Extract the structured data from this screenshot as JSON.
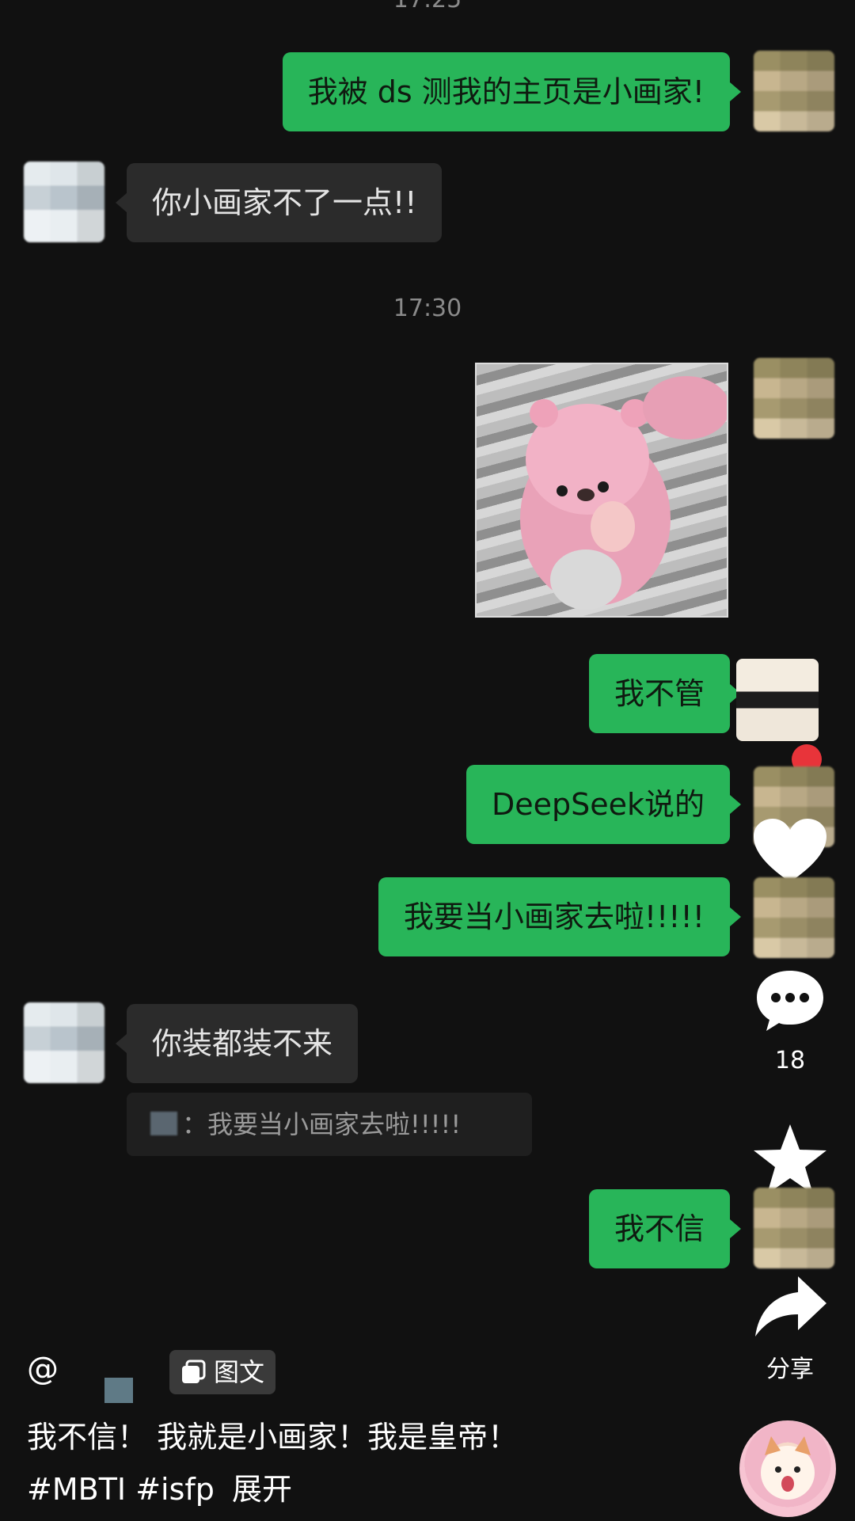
{
  "timestamps": {
    "top": "17:25",
    "middle": "17:30"
  },
  "messages": [
    {
      "side": "me",
      "text": "我被 ds 测我的主页是小画家!"
    },
    {
      "side": "them",
      "text": "你小画家不了一点!!"
    },
    {
      "side": "me",
      "type": "sticker",
      "text": ""
    },
    {
      "side": "me",
      "text": "我不管"
    },
    {
      "side": "me",
      "text": "DeepSeek说的"
    },
    {
      "side": "me",
      "text": "我要当小画家去啦!!!!!"
    },
    {
      "side": "them",
      "text": "你装都装不来"
    },
    {
      "side": "quote",
      "text": "：我要当小画家去啦!!!!!"
    },
    {
      "side": "me",
      "text": "我不信"
    }
  ],
  "side_actions": {
    "comment_count": "18",
    "share_label": "分享"
  },
  "post": {
    "at_symbol": "@",
    "type_tag": "图文",
    "caption": "我不信！ 我就是小画家！我是皇帝！",
    "hashtags": "#MBTI #isfp",
    "expand_label": "展开"
  },
  "icons": [
    "heart-icon",
    "comment-icon",
    "star-icon",
    "share-icon",
    "image-text-icon"
  ],
  "colors": {
    "bubble_mine": "#28b559",
    "bubble_theirs": "#2b2b2b",
    "background": "#111111"
  }
}
